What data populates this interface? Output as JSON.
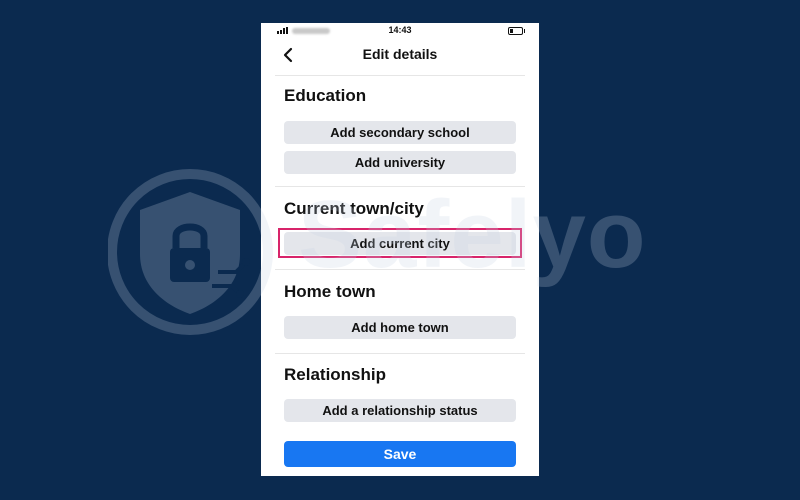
{
  "status_bar": {
    "time": "14:43"
  },
  "nav": {
    "title": "Edit details",
    "back_icon": "chevron-left-icon"
  },
  "sections": {
    "education": {
      "title": "Education",
      "secondary_school_label": "Add secondary school",
      "university_label": "Add university"
    },
    "current_city": {
      "title": "Current town/city",
      "add_label": "Add current city"
    },
    "home_town": {
      "title": "Home town",
      "add_label": "Add home town"
    },
    "relationship": {
      "title": "Relationship",
      "add_label": "Add a relationship status"
    }
  },
  "save": {
    "label": "Save"
  },
  "watermark": {
    "text": "Safelyo"
  },
  "colors": {
    "background": "#0b2a4f",
    "save_button": "#1877f2",
    "action_button": "#e4e6eb",
    "highlight": "#d8246a"
  }
}
